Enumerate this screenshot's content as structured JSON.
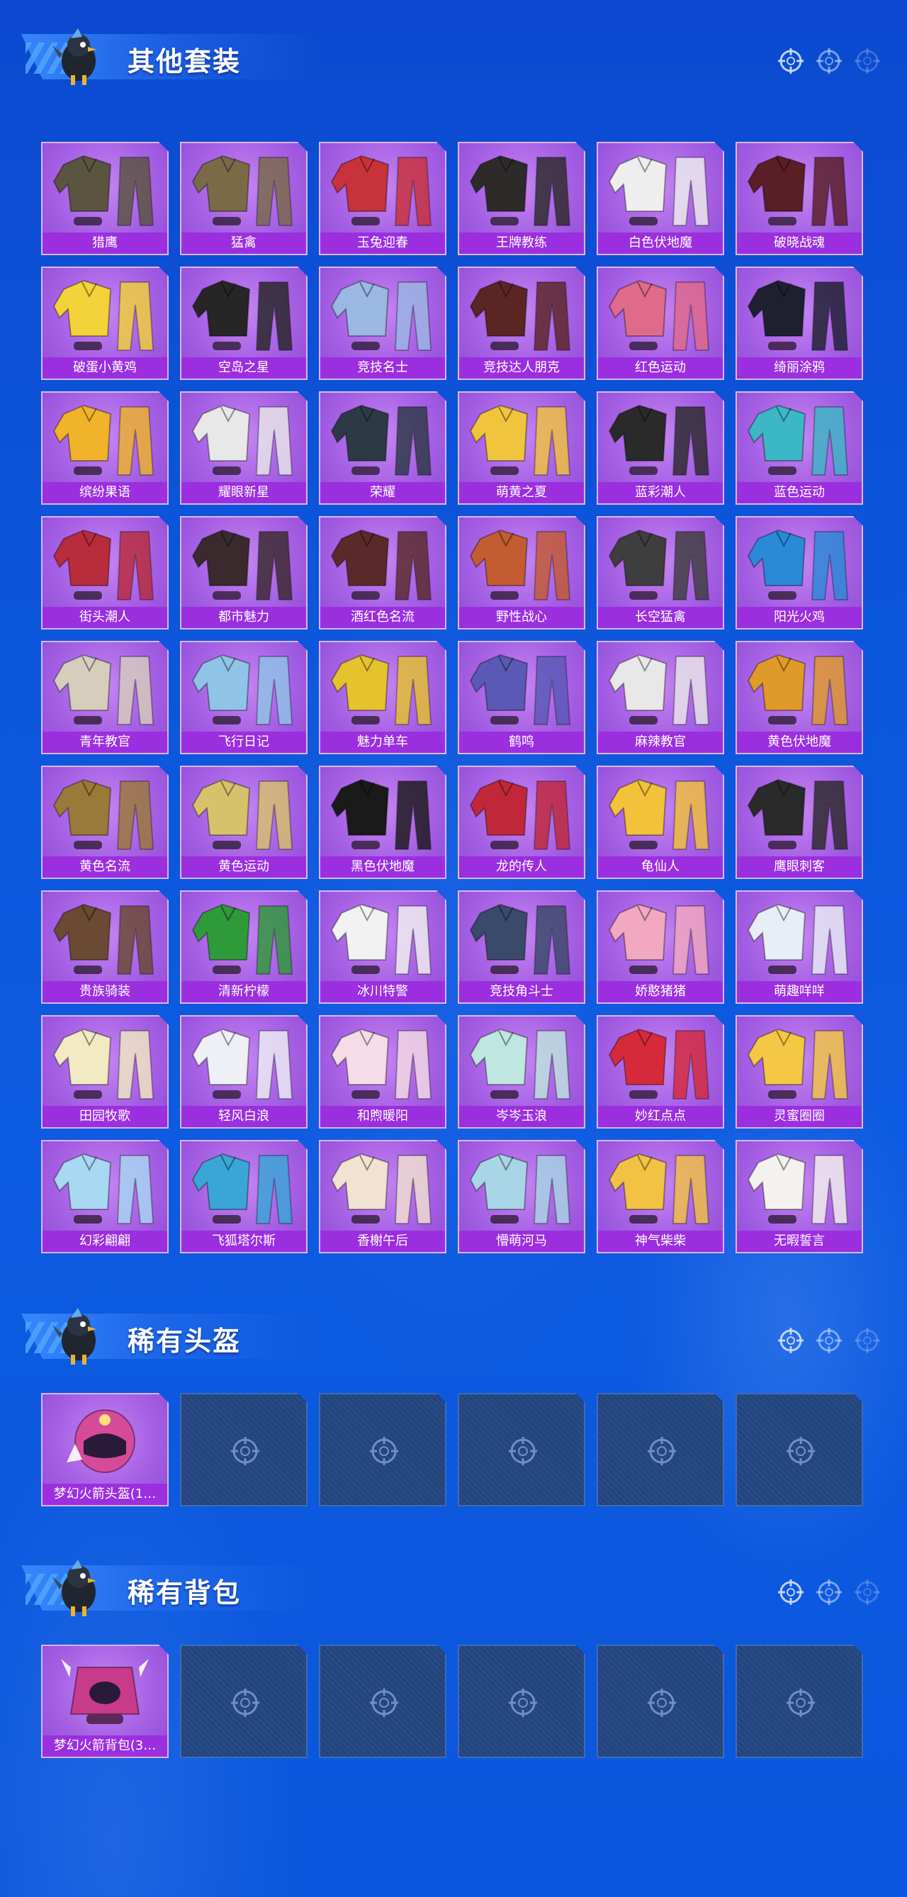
{
  "colors": {
    "background": "#0c55da",
    "card_bg": "#a660e4",
    "label_bg": "#9b2fe0",
    "empty_slot": "#23457e",
    "title_text": "#ffffff"
  },
  "sections": [
    {
      "title": "其他套装",
      "icons": [
        "crosshair-icon",
        "crosshair-icon",
        "crosshair-icon"
      ],
      "items": [
        {
          "name": "猎鹰",
          "color": "#5a5440"
        },
        {
          "name": "猛禽",
          "color": "#7a6a48"
        },
        {
          "name": "玉兔迎春",
          "color": "#c8323a"
        },
        {
          "name": "王牌教练",
          "color": "#2d2a2a"
        },
        {
          "name": "白色伏地魔",
          "color": "#eeeeee"
        },
        {
          "name": "破晓战魂",
          "color": "#5a1e26"
        },
        {
          "name": "破蛋小黄鸡",
          "color": "#f4d23a"
        },
        {
          "name": "空岛之星",
          "color": "#262626"
        },
        {
          "name": "竞技名士",
          "color": "#9bb8e4"
        },
        {
          "name": "竞技达人朋克",
          "color": "#5b2524"
        },
        {
          "name": "红色运动",
          "color": "#e06a8a"
        },
        {
          "name": "绮丽涂鸦",
          "color": "#1e2030"
        },
        {
          "name": "缤纷果语",
          "color": "#f0b32a"
        },
        {
          "name": "耀眼新星",
          "color": "#e8e8e8"
        },
        {
          "name": "荣耀",
          "color": "#2c3a46"
        },
        {
          "name": "萌黄之夏",
          "color": "#f1c43e"
        },
        {
          "name": "蓝彩潮人",
          "color": "#2a2a2a"
        },
        {
          "name": "蓝色运动",
          "color": "#3cb7c6"
        },
        {
          "name": "街头潮人",
          "color": "#b82c3c"
        },
        {
          "name": "都市魅力",
          "color": "#3a2a2e"
        },
        {
          "name": "酒红色名流",
          "color": "#5a2a2a"
        },
        {
          "name": "野性战心",
          "color": "#c45c32"
        },
        {
          "name": "长空猛禽",
          "color": "#3e3e3e"
        },
        {
          "name": "阳光火鸡",
          "color": "#2a8ad8"
        },
        {
          "name": "青年教官",
          "color": "#d6cdbd"
        },
        {
          "name": "飞行日记",
          "color": "#8fc4e8"
        },
        {
          "name": "魅力单车",
          "color": "#e6c22e"
        },
        {
          "name": "鹤鸣",
          "color": "#5a5ab6"
        },
        {
          "name": "麻辣教官",
          "color": "#e8e8e8"
        },
        {
          "name": "黄色伏地魔",
          "color": "#e09a2a"
        },
        {
          "name": "黄色名流",
          "color": "#9a7a38"
        },
        {
          "name": "黄色运动",
          "color": "#d6c26a"
        },
        {
          "name": "黑色伏地魔",
          "color": "#1a1a1a"
        },
        {
          "name": "龙的传人",
          "color": "#c0283a"
        },
        {
          "name": "龟仙人",
          "color": "#f2c23a"
        },
        {
          "name": "鹰眼刺客",
          "color": "#2a2a2a"
        },
        {
          "name": "贵族骑装",
          "color": "#6a4a32"
        },
        {
          "name": "清新柠檬",
          "color": "#2f9a3a"
        },
        {
          "name": "冰川特警",
          "color": "#f2f2f2"
        },
        {
          "name": "竞技角斗士",
          "color": "#3a4a6a"
        },
        {
          "name": "娇憨猪猪",
          "color": "#f2a8c0"
        },
        {
          "name": "萌趣咩咩",
          "color": "#e8eef6"
        },
        {
          "name": "田园牧歌",
          "color": "#f2eac2"
        },
        {
          "name": "轻风白浪",
          "color": "#eef0f6"
        },
        {
          "name": "和煦暖阳",
          "color": "#f6dce6"
        },
        {
          "name": "岑岑玉浪",
          "color": "#bfe6e0"
        },
        {
          "name": "妙红点点",
          "color": "#d62a3a"
        },
        {
          "name": "灵蜜圈圈",
          "color": "#f4c844"
        },
        {
          "name": "幻彩翩翩",
          "color": "#a8d8f2"
        },
        {
          "name": "飞狐塔尔斯",
          "color": "#3aa6d8"
        },
        {
          "name": "香榭午后",
          "color": "#f2e2d2"
        },
        {
          "name": "懵萌河马",
          "color": "#a8d6e6"
        },
        {
          "name": "神气柴柴",
          "color": "#f2c244"
        },
        {
          "name": "无暇誓言",
          "color": "#f4f2ee"
        }
      ]
    },
    {
      "title": "稀有头盔",
      "icons": [
        "crosshair-icon",
        "crosshair-icon",
        "crosshair-icon"
      ],
      "items": [
        {
          "name": "梦幻火箭头盔(1…",
          "color": "#d64a9a"
        }
      ],
      "empty_slots": 5
    },
    {
      "title": "稀有背包",
      "icons": [
        "crosshair-icon",
        "crosshair-icon",
        "crosshair-icon"
      ],
      "items": [
        {
          "name": "梦幻火箭背包(3…",
          "color": "#c83a8a"
        }
      ],
      "empty_slots": 5
    }
  ]
}
